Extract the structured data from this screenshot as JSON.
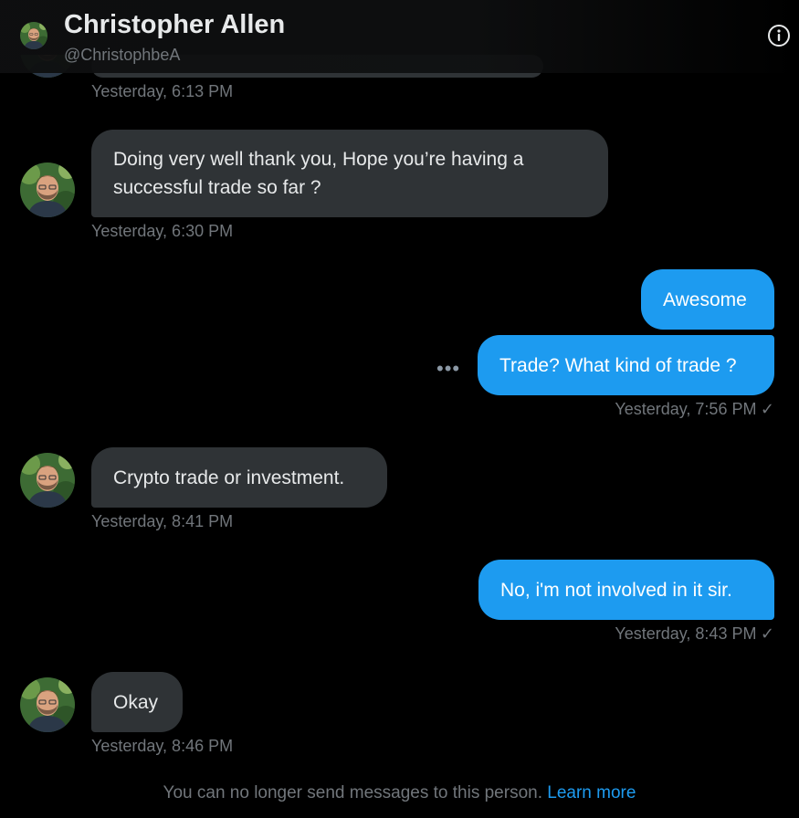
{
  "header": {
    "name": "Christopher Allen",
    "handle": "@ChristophbeA",
    "info_icon": "info-circle-icon"
  },
  "messages": [
    {
      "from": "them",
      "text": "",
      "time": "Yesterday, 6:13 PM"
    },
    {
      "from": "them",
      "text_line1": "Doing very well thank you, Hope you’re having a",
      "text_line2": "successful trade so far ?",
      "time": "Yesterday, 6:30 PM"
    },
    {
      "from": "me",
      "text": "Awesome"
    },
    {
      "from": "me",
      "text": "Trade? What kind of trade ?",
      "time": "Yesterday, 7:56 PM",
      "status": "✓"
    },
    {
      "from": "them",
      "text": "Crypto trade or investment.",
      "time": "Yesterday, 8:41 PM"
    },
    {
      "from": "me",
      "text": "No, i'm not involved in it sir.",
      "time": "Yesterday, 8:43 PM",
      "status": "✓"
    },
    {
      "from": "them",
      "text": "Okay",
      "time": "Yesterday, 8:46 PM"
    }
  ],
  "more_icon": "more-horizontal-icon",
  "footer": {
    "notice": "You can no longer send messages to this person.",
    "link": "Learn more"
  },
  "colors": {
    "background": "#000000",
    "incoming_bubble": "#2f3336",
    "outgoing_bubble": "#1d9bf0",
    "muted_text": "#71767b"
  }
}
